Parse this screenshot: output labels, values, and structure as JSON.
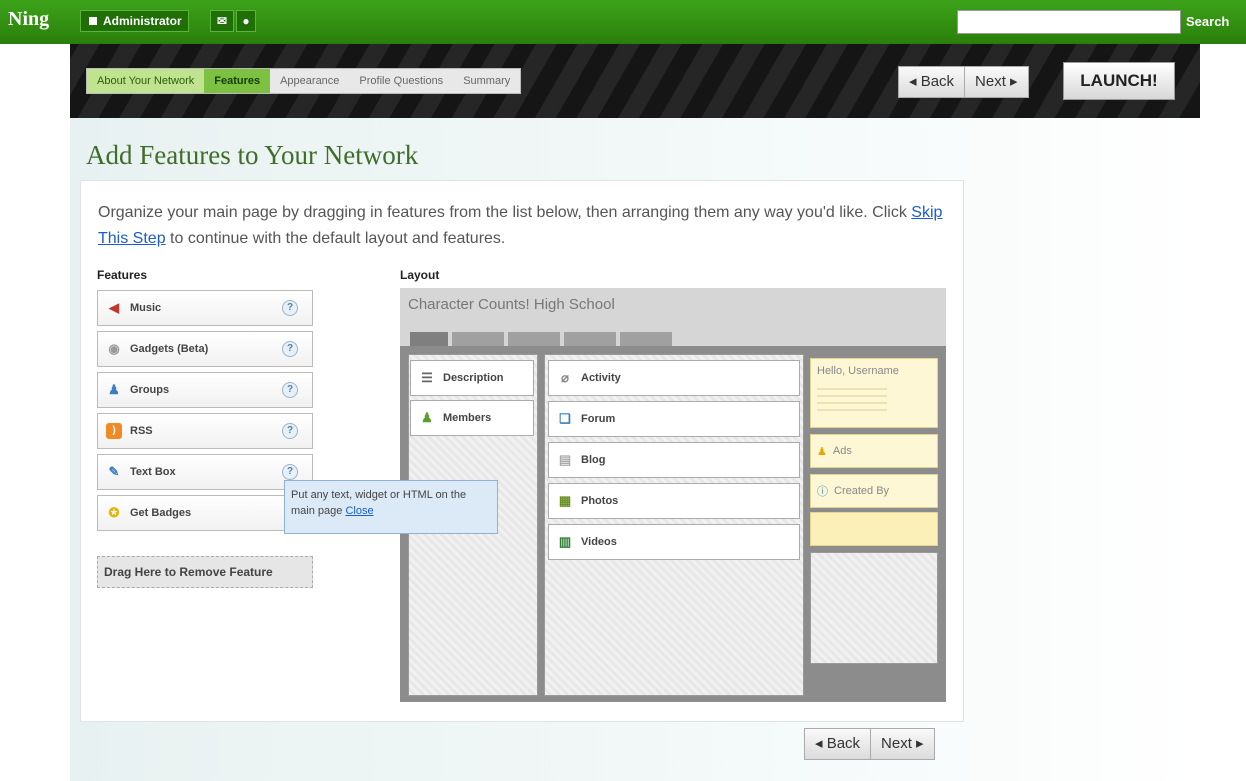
{
  "topbar": {
    "logo": "Ning",
    "admin_label": "Administrator",
    "search_placeholder": "",
    "search_label": "Search"
  },
  "wizard": {
    "steps": [
      "About Your Network",
      "Features",
      "Appearance",
      "Profile Questions",
      "Summary"
    ],
    "active_step": "Features",
    "back_label": "◂ Back",
    "next_label": "Next ▸",
    "launch_label": "LAUNCH!"
  },
  "page": {
    "title": "Add Features to Your Network",
    "intro_before": "Organize your main page by dragging in features from the list below, then arranging them any way you'd like. Click ",
    "intro_link": "Skip This Step",
    "intro_after": " to continue with the default layout and features."
  },
  "features": {
    "heading": "Features",
    "items": [
      "Music",
      "Gadgets (Beta)",
      "Groups",
      "RSS",
      "Text Box",
      "Get Badges"
    ],
    "drop_label": "Drag Here to Remove Feature",
    "tooltip_text": "Put any text, widget or HTML on the main page ",
    "tooltip_close": "Close"
  },
  "layout": {
    "heading": "Layout",
    "network_name": "Character Counts! High School",
    "left_modules": [
      "Description",
      "Members"
    ],
    "center_modules": [
      "Activity",
      "Forum",
      "Blog",
      "Photos",
      "Videos"
    ],
    "right_modules": {
      "greeting": "Hello, Username",
      "ads": "Ads",
      "created_by": "Created By"
    }
  },
  "bottom_nav": {
    "back_label": "◂ Back",
    "next_label": "Next ▸"
  },
  "colors": {
    "topbar_green": "#3da31a",
    "active_step": "#7dc142",
    "title_green": "#3f6d2a",
    "link_blue": "#1d5ccf"
  }
}
